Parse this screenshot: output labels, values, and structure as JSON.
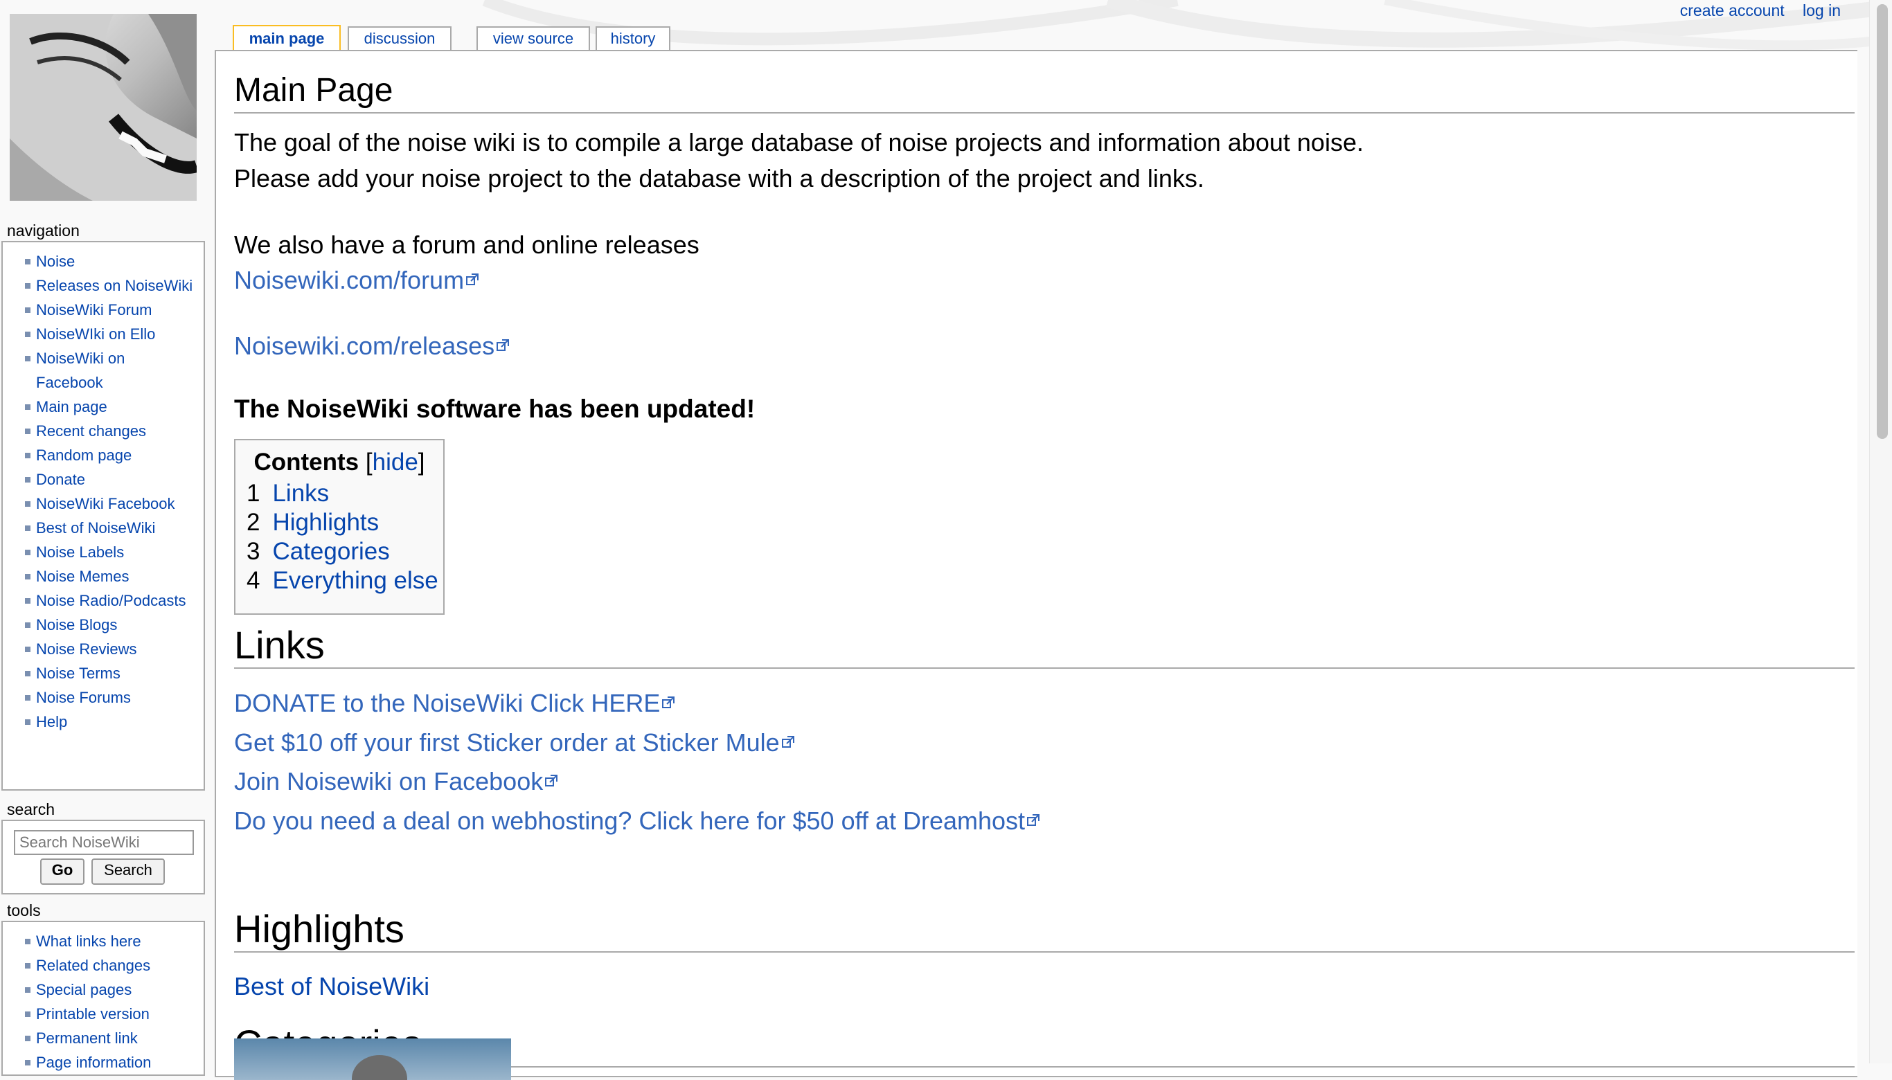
{
  "personal_tools": {
    "create_account": "create account",
    "log_in": "log in"
  },
  "tabs": {
    "main_page": "main page",
    "discussion": "discussion",
    "view_source": "view source",
    "history": "history"
  },
  "page": {
    "title": "Main Page",
    "intro_line1": "The goal of the noise wiki is to compile a large database of noise projects and information about noise.",
    "intro_line2": "Please add your noise project to the database with a description of the project and links.",
    "forum_line": "We also have a forum and online releases",
    "forum_link": "Noisewiki.com/forum",
    "releases_link": "Noisewiki.com/releases",
    "updated_notice": "The NoiseWiki software has been updated!"
  },
  "toc": {
    "title": "Contents",
    "hide": "hide",
    "items": [
      {
        "num": "1",
        "label": "Links"
      },
      {
        "num": "2",
        "label": "Highlights"
      },
      {
        "num": "3",
        "label": "Categories"
      },
      {
        "num": "4",
        "label": "Everything else"
      }
    ]
  },
  "sections": {
    "links": {
      "heading": "Links",
      "items": [
        "DONATE to the NoiseWiki Click HERE",
        "Get $10 off your first Sticker order at Sticker Mule",
        "Join Noisewiki on Facebook",
        "Do you need a deal on webhosting? Click here for $50 off at Dreamhost"
      ]
    },
    "highlights": {
      "heading": "Highlights",
      "item": "Best of NoiseWiki"
    },
    "categories": {
      "heading": "Categories"
    }
  },
  "sidebar": {
    "navigation": {
      "heading": "navigation",
      "items": [
        "Noise",
        "Releases on NoiseWiki",
        "NoiseWiki Forum",
        "NoiseWIki on Ello",
        "NoiseWiki on Facebook",
        "Main page",
        "Recent changes",
        "Random page",
        "Donate",
        "NoiseWiki Facebook",
        "Best of NoiseWiki",
        "Noise Labels",
        "Noise Memes",
        "Noise Radio/Podcasts",
        "Noise Blogs",
        "Noise Reviews",
        "Noise Terms",
        "Noise Forums",
        "Help"
      ]
    },
    "search": {
      "heading": "search",
      "placeholder": "Search NoiseWiki",
      "go": "Go",
      "search": "Search"
    },
    "tools": {
      "heading": "tools",
      "items": [
        "What links here",
        "Related changes",
        "Special pages",
        "Printable version",
        "Permanent link",
        "Page information"
      ]
    }
  },
  "colors": {
    "link": "#0645ad",
    "external_link": "#3366bb",
    "selected_tab_border": "#fabd23",
    "border": "#aaaaaa"
  }
}
